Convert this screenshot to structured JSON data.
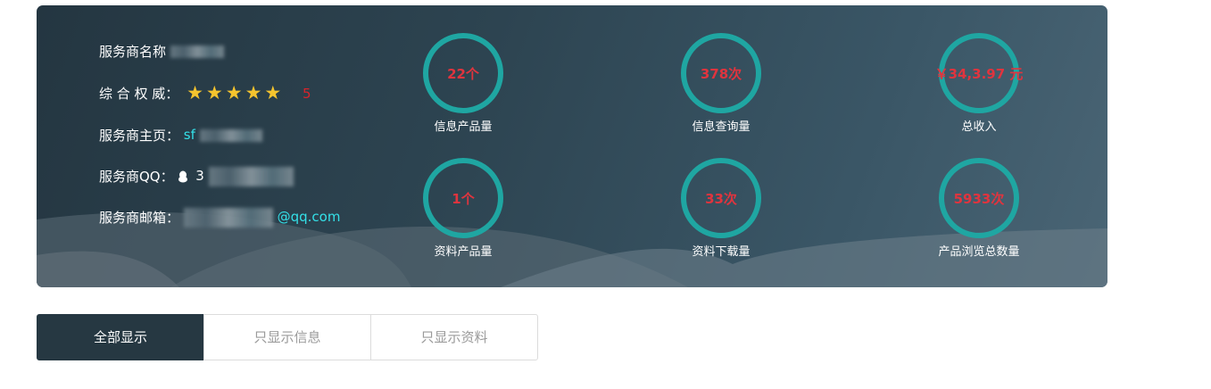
{
  "provider": {
    "name_label": "服务商名称",
    "rating_label": "综 合 权 威：",
    "rating_value": 5,
    "rating_score": "5",
    "homepage_label": "服务商主页：",
    "homepage_value": "sf",
    "qq_label": "服务商QQ：",
    "qq_value": "3",
    "email_label": "服务商邮箱：",
    "email_value": "@qq.com"
  },
  "stats": [
    {
      "value": "22个",
      "label": "信息产品量"
    },
    {
      "value": "378次",
      "label": "信息查询量"
    },
    {
      "value": "￥34,3.97 元",
      "label": "总收入"
    },
    {
      "value": "1个",
      "label": "资料产品量"
    },
    {
      "value": "33次",
      "label": "资料下载量"
    },
    {
      "value": "5933次",
      "label": "产品浏览总数量"
    }
  ],
  "tabs": [
    {
      "label": "全部显示",
      "active": true
    },
    {
      "label": "只显示信息",
      "active": false
    },
    {
      "label": "只显示资料",
      "active": false
    }
  ],
  "colors": {
    "ring": "#1fa6a2",
    "stat_value": "#e0343e",
    "star": "#f5c42e",
    "link": "#34e0e8",
    "active_tab": "#263842"
  }
}
